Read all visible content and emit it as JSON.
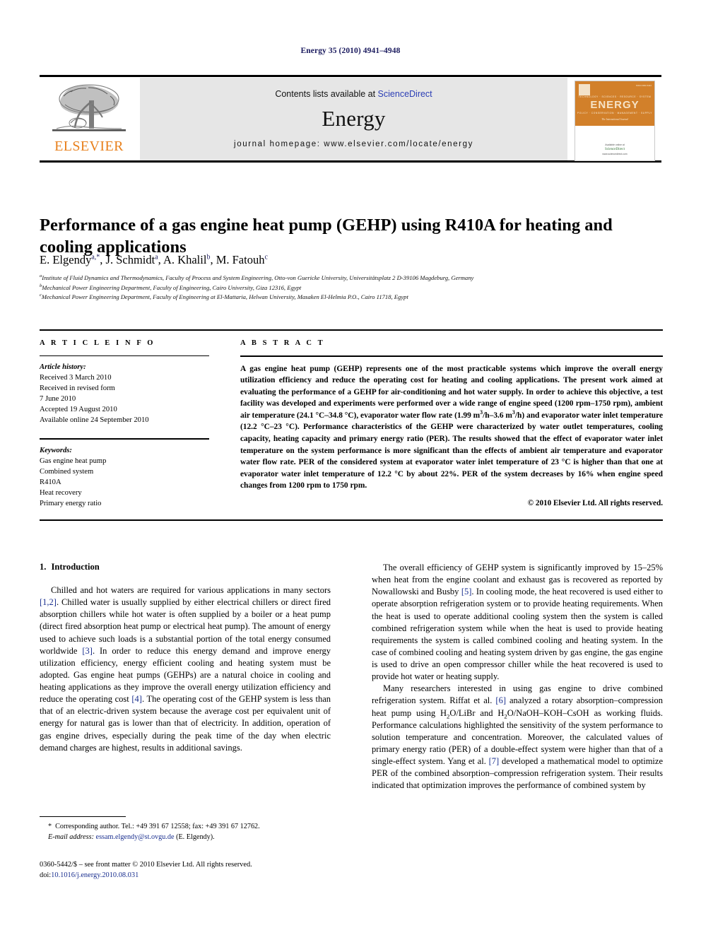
{
  "running_head": "Energy 35 (2010) 4941–4948",
  "masthead": {
    "contents_prefix": "Contents lists available at ",
    "sciencedirect": "ScienceDirect",
    "journal_name": "Energy",
    "homepage": "journal homepage: www.elsevier.com/locate/energy",
    "publisher_wordmark": "ELSEVIER",
    "cover": {
      "title": "ENERGY",
      "top_row": "TECHNOLOGY · SCIENCES · RESOURCE · SYSTEM",
      "bottom_row": "POLICY · CONSERVATION · MANAGEMENT · SUPPLY",
      "subtitle": "The International Journal",
      "available_label": "Available online at",
      "sd_name": "ScienceDirect",
      "sd_url": "www.sciencedirect.com",
      "issn": "ISSN 0360-5442"
    }
  },
  "article": {
    "title": "Performance of a gas engine heat pump (GEHP) using R410A for heating and cooling applications",
    "authors": [
      {
        "name": "E. Elgendy",
        "marks": "a,*"
      },
      {
        "name": "J. Schmidt",
        "marks": "a"
      },
      {
        "name": "A. Khalil",
        "marks": "b"
      },
      {
        "name": "M. Fatouh",
        "marks": "c"
      }
    ],
    "affiliations": [
      {
        "mark": "a",
        "text": "Institute of Fluid Dynamics and Thermodynamics, Faculty of Process and System Engineering, Otto-von Guericke University, Universitätsplatz 2 D-39106 Magdeburg, Germany"
      },
      {
        "mark": "b",
        "text": "Mechanical Power Engineering Department, Faculty of Engineering, Cairo University, Giza 12316, Egypt"
      },
      {
        "mark": "c",
        "text": "Mechanical Power Engineering Department, Faculty of Engineering at El-Mattaria, Helwan University, Masaken El-Helmia P.O., Cairo 11718, Egypt"
      }
    ]
  },
  "info": {
    "heading": "A R T I C L E  I N F O",
    "history_label": "Article history:",
    "history": [
      "Received 3 March 2010",
      "Received in revised form",
      "7 June 2010",
      "Accepted 19 August 2010",
      "Available online 24 September 2010"
    ],
    "keywords_label": "Keywords:",
    "keywords": [
      "Gas engine heat pump",
      "Combined system",
      "R410A",
      "Heat recovery",
      "Primary energy ratio"
    ]
  },
  "abstract": {
    "heading": "A B S T R A C T",
    "copyright": "© 2010 Elsevier Ltd. All rights reserved."
  },
  "sections": {
    "introduction_number": "1.",
    "introduction_title": "Introduction"
  },
  "footnote": {
    "star": "*",
    "corresponding": "Corresponding author. Tel.: +49 391 67 12558; fax: +49 391 67 12762.",
    "email_label": "E-mail address:",
    "email": "essam.elgendy@st.ovgu.de",
    "email_owner": "(E. Elgendy)."
  },
  "imprint": {
    "front_matter": "0360-5442/$ – see front matter © 2010 Elsevier Ltd. All rights reserved.",
    "doi_label": "doi:",
    "doi": "10.1016/j.energy.2010.08.031"
  },
  "colors": {
    "running_head": "#1a1a5e",
    "link": "#1a2f8f",
    "sciencedirect": "#2b3eb5",
    "elsevier_orange": "#e8801c",
    "band_gray": "#e6e6e6"
  }
}
